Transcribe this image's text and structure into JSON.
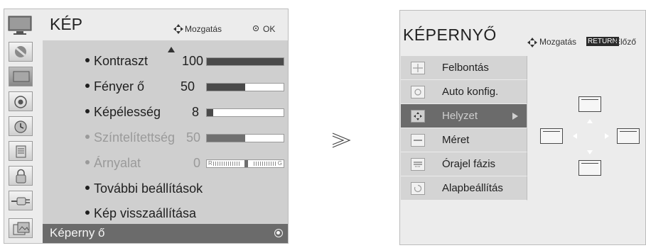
{
  "left_panel": {
    "title": "KÉP",
    "hint_move": "Mozgatás",
    "hint_ok": "OK",
    "side_icons": [
      "picture-menu-icon",
      "screen-icon",
      "audio-icon",
      "clock-icon",
      "option-icon",
      "lock-icon",
      "input-icon",
      "usb-photo-icon"
    ],
    "items": [
      {
        "label": "Kontraszt",
        "value": "100",
        "level": 1.0,
        "enabled": true
      },
      {
        "label": "Fényer ő",
        "value": "50",
        "level": 0.5,
        "enabled": true
      },
      {
        "label": "Képélesség",
        "value": "8",
        "level": 0.08,
        "enabled": true
      },
      {
        "label": "Színtelítettség",
        "value": "50",
        "level": 0.5,
        "enabled": false
      },
      {
        "label": "Árnyalat",
        "value": "0",
        "enabled": false
      },
      {
        "label": "További beállítások",
        "enabled": true
      },
      {
        "label": "Kép visszaállítása",
        "enabled": true
      }
    ],
    "tint_left": "R",
    "tint_right": "G",
    "selected_item": "Képerny ő"
  },
  "right_panel": {
    "title": "KÉPERNYŐ",
    "hint_move": "Mozgatás",
    "return_label": "RETURN",
    "prev_label": "Előző",
    "items": [
      {
        "label": "Felbontás",
        "icon": "resolution-icon",
        "active": false
      },
      {
        "label": "Auto konfig.",
        "icon": "auto-config-icon",
        "active": false
      },
      {
        "label": "Helyzet",
        "icon": "position-icon",
        "active": true
      },
      {
        "label": "Méret",
        "icon": "size-icon",
        "active": false
      },
      {
        "label": "Órajel fázis",
        "icon": "clock-phase-icon",
        "active": false
      },
      {
        "label": "Alapbeállítás",
        "icon": "reset-icon",
        "active": false
      }
    ]
  },
  "colors": {
    "panel_bg": "#ececec",
    "menu_bg": "#cfcfcf",
    "selected_bg": "#6b6b6b",
    "bar_fill": "#4a4a4a"
  }
}
